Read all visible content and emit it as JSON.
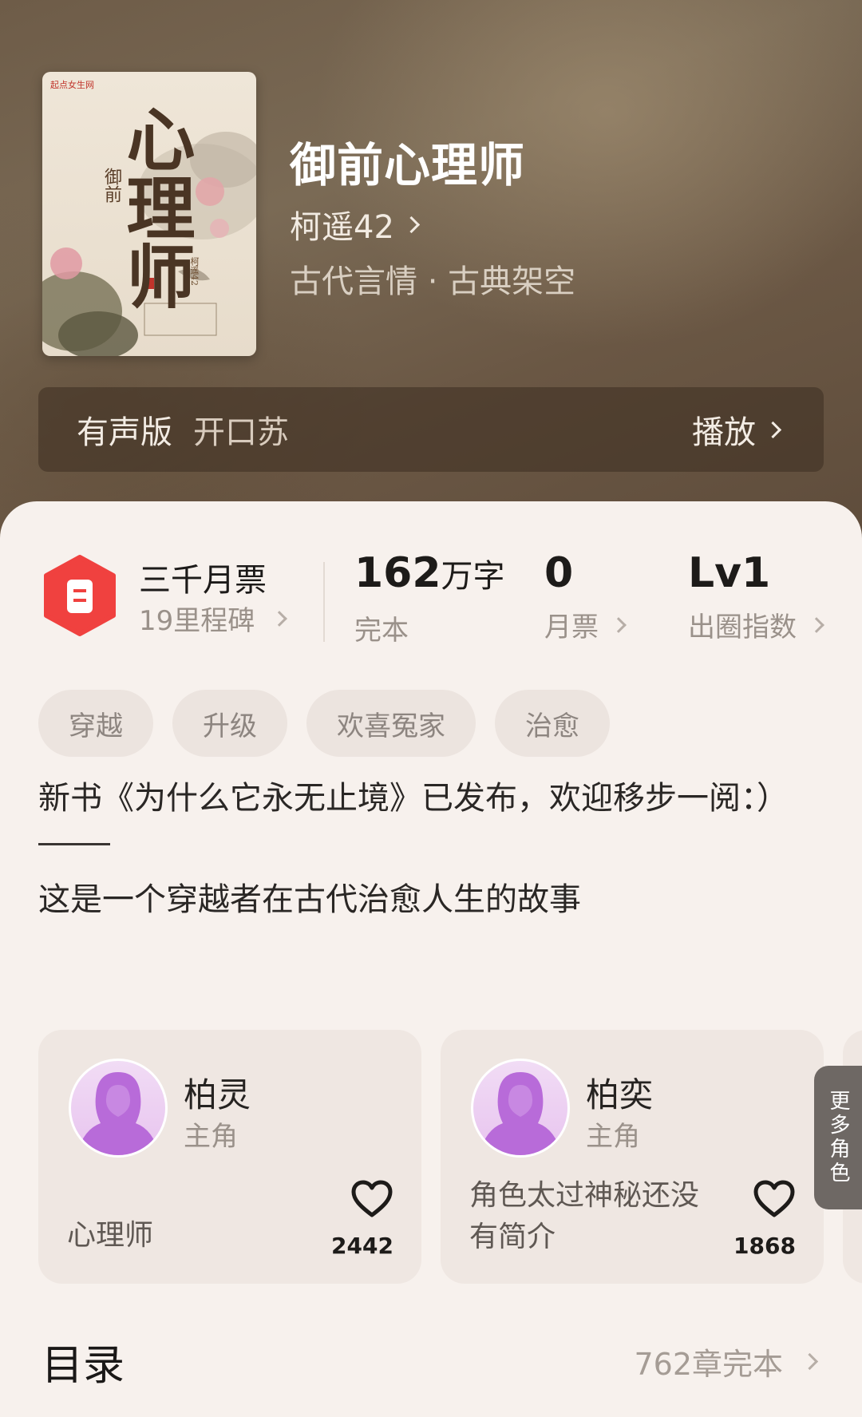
{
  "book": {
    "title": "御前心理师",
    "author": "柯遥42",
    "genre": "古代言情 · 古典架空",
    "cover": {
      "logo": "起点女生网",
      "title": "心理师",
      "subtitle": "御前",
      "author": "柯遥42"
    }
  },
  "audio": {
    "label": "有声版",
    "narrator": "开口苏",
    "play_label": "播放"
  },
  "stats": {
    "ticket_title": "三千月票",
    "ticket_sub": "19里程碑",
    "word_count": "162",
    "word_unit": "万字",
    "status": "完本",
    "monthly_votes": "0",
    "monthly_votes_label": "月票",
    "level": "Lv1",
    "level_label": "出圈指数"
  },
  "tags": [
    "穿越",
    "升级",
    "欢喜冤家",
    "治愈"
  ],
  "intro": {
    "line1": "新书《为什么它永无止境》已发布，欢迎移步一阅：）",
    "line2": "这是一个穿越者在古代治愈人生的故事"
  },
  "roles": [
    {
      "name": "柏灵",
      "type": "主角",
      "desc": "心理师",
      "likes": "2442"
    },
    {
      "name": "柏奕",
      "type": "主角",
      "desc": "角色太过神秘还没有简介",
      "likes": "1868"
    }
  ],
  "more_roles_label": "更多角色",
  "toc": {
    "title": "目录",
    "meta": "762章完本"
  },
  "colors": {
    "ticket_red": "#f0413f",
    "avatar_purple": "#b86bd9"
  }
}
